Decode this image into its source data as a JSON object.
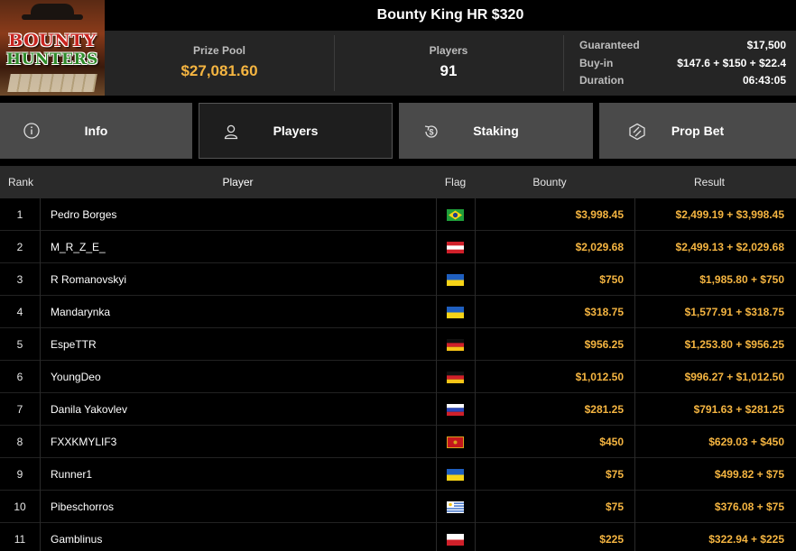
{
  "tournament": {
    "title": "Bounty King HR $320",
    "logo_text_top": "BOUNTY",
    "logo_text_bottom": "HUNTERS"
  },
  "stats": {
    "prize_pool_label": "Prize Pool",
    "prize_pool_value": "$27,081.60",
    "players_label": "Players",
    "players_value": "91",
    "guaranteed_label": "Guaranteed",
    "guaranteed_value": "$17,500",
    "buyin_label": "Buy-in",
    "buyin_value": "$147.6 + $150 + $22.4",
    "duration_label": "Duration",
    "duration_value": "06:43:05"
  },
  "tabs": [
    {
      "label": "Info",
      "icon": "info-icon"
    },
    {
      "label": "Players",
      "icon": "user-icon",
      "active": true
    },
    {
      "label": "Staking",
      "icon": "dollar-cycle-icon"
    },
    {
      "label": "Prop Bet",
      "icon": "prop-bet-icon"
    }
  ],
  "table": {
    "headers": {
      "rank": "Rank",
      "player": "Player",
      "flag": "Flag",
      "bounty": "Bounty",
      "result": "Result"
    },
    "rows": [
      {
        "rank": "1",
        "player": "Pedro Borges",
        "flag": "brazil",
        "bounty": "$3,998.45",
        "result": "$2,499.19 + $3,998.45"
      },
      {
        "rank": "2",
        "player": "M_R_Z_E_",
        "flag": "austria",
        "bounty": "$2,029.68",
        "result": "$2,499.13 + $2,029.68"
      },
      {
        "rank": "3",
        "player": "R Romanovskyi",
        "flag": "ukraine",
        "bounty": "$750",
        "result": "$1,985.80 + $750"
      },
      {
        "rank": "4",
        "player": "Mandarynka",
        "flag": "ukraine",
        "bounty": "$318.75",
        "result": "$1,577.91 + $318.75"
      },
      {
        "rank": "5",
        "player": "EspeTTR",
        "flag": "germany",
        "bounty": "$956.25",
        "result": "$1,253.80 + $956.25"
      },
      {
        "rank": "6",
        "player": "YoungDeo",
        "flag": "germany",
        "bounty": "$1,012.50",
        "result": "$996.27 + $1,012.50"
      },
      {
        "rank": "7",
        "player": "Danila Yakovlev",
        "flag": "russia",
        "bounty": "$281.25",
        "result": "$791.63 + $281.25"
      },
      {
        "rank": "8",
        "player": "FXXKMYLIF3",
        "flag": "montenegro",
        "bounty": "$450",
        "result": "$629.03 + $450"
      },
      {
        "rank": "9",
        "player": "Runner1",
        "flag": "ukraine",
        "bounty": "$75",
        "result": "$499.82 + $75"
      },
      {
        "rank": "10",
        "player": "Pibeschorros",
        "flag": "uruguay",
        "bounty": "$75",
        "result": "$376.08 + $75"
      },
      {
        "rank": "11",
        "player": "Gamblinus",
        "flag": "poland",
        "bounty": "$225",
        "result": "$322.94 + $225"
      }
    ]
  },
  "colors": {
    "accent": "#f5b541",
    "tab_bg": "#4a4a4a",
    "active_tab_bg": "#1e1e1e",
    "header_bg": "#2a2a2a"
  }
}
